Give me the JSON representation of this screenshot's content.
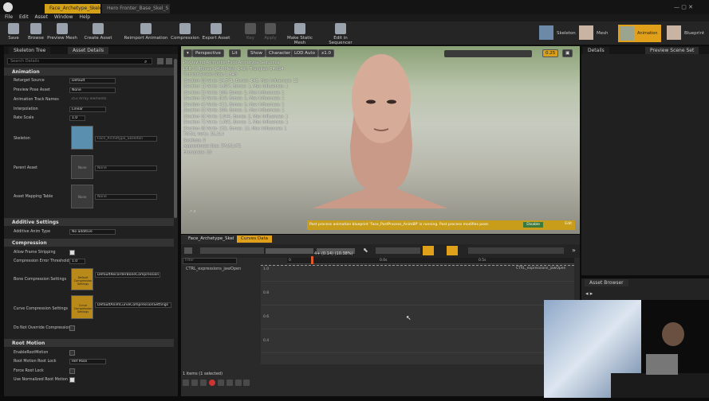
{
  "window": {
    "tabs": [
      "Face_Archetype_Skeleton",
      "Hero Fronter_Base_Skel_S"
    ],
    "menu": [
      "File",
      "Edit",
      "Asset",
      "Window",
      "Help"
    ]
  },
  "toolbar": {
    "buttons": [
      "Save",
      "Browse",
      "Preview Mesh",
      "Create Asset",
      "Reimport Animation",
      "Compression",
      "Export Asset",
      "Key",
      "Apply",
      "Make Static Mesh",
      "Edit in Sequencer"
    ],
    "modes": [
      "Skeleton",
      "Mesh",
      "Animation",
      "Blueprint"
    ]
  },
  "left_panel": {
    "tabs": [
      "Skeleton Tree",
      "Asset Details"
    ],
    "search_placeholder": "Search Details",
    "sections": {
      "animation": "Animation",
      "additive": "Additive Settings",
      "compression": "Compression",
      "root_motion": "Root Motion"
    },
    "props": {
      "retarget_source": {
        "label": "Retarget Source",
        "value": "Default"
      },
      "preview_pose": {
        "label": "Preview Pose Asset",
        "value": "None"
      },
      "track_names": {
        "label": "Animation Track Names",
        "value": "353 Array elements"
      },
      "interpolation": {
        "label": "Interpolation",
        "value": "Linear"
      },
      "rate_scale": {
        "label": "Rate Scale",
        "value": "1.0"
      },
      "skeleton": {
        "label": "Skeleton",
        "value": "Face_Archetype_Skeleton"
      },
      "parent_asset": {
        "label": "Parent Asset",
        "value": "None"
      },
      "mapping_table": {
        "label": "Asset Mapping Table",
        "value": "None"
      },
      "additive_type": {
        "label": "Additive Anim Type",
        "value": "No additive"
      },
      "allow_stripping": {
        "label": "Allow Frame Stripping"
      },
      "error_threshold": {
        "label": "Compression Error Threshold",
        "value": "1.0"
      },
      "bone_compression": {
        "label": "Bone Compression Settings",
        "value": "DefaultRecorderBoneCompression"
      },
      "curve_compression": {
        "label": "Curve Compression Settings",
        "value": "DefaultAnimCurveCompressionSettings"
      },
      "no_override": {
        "label": "Do Not Override Compression"
      },
      "enable_root": {
        "label": "EnableRootMotion"
      },
      "root_lock": {
        "label": "Root Motion Root Lock",
        "value": "Ref Pose"
      },
      "force_lock": {
        "label": "Force Root Lock"
      },
      "normalized_root": {
        "label": "Use Normalized Root Motion"
      }
    },
    "thumb_bone": "Default Compression Settings",
    "thumb_curve": "Curve Compression Settings",
    "thumb_none": "None"
  },
  "viewport": {
    "controls": [
      "Perspective",
      "Lit",
      "Show",
      "Character",
      "LOD Auto",
      "x1.0"
    ],
    "fov": "0.25",
    "info": [
      "Previewing Animation Face Archetype Sequence",
      "LOD: 0, Bones: 149 (Mesh: 149), Triangles: 54,094",
      "Current Screen Size: 1.648",
      "[Section 0] Verts: 24,571, Bones: 145, Max Influences: 12",
      "[Section 1] Verts: 4,697, Bones: 1, Max Influences: 1",
      "[Section 2] Verts: 108, Bones: 2, Max Influences: 1",
      "[Section 3] Verts: 819, Bones: 2, Max Influences: 1",
      "[Section 4] Verts: 411, Bones: 3, Max Influences: 1",
      "[Section 5] Verts: 200, Bones: 2, Max Influences: 1",
      "[Section 6] Verts: 2,944, Bones: 2, Max Influences: 1",
      "[Section 7] Verts: 1,092, Bones: 1, Max Influences: 1",
      "[Section 8] Verts: 232, Bones: 12, Max Influences: 1",
      "TOTAL Verts: 35,314",
      "Sections: 9",
      "Approximate Size: 37x51x72",
      "Framerate: 30"
    ],
    "notification": "Post process animation blueprint 'Face_PostProcess_AnimBP' is running. Post process modifies pose.",
    "notification_link": "Disable",
    "notification_edit": "Edit"
  },
  "right_panel": {
    "tabs": [
      "Details",
      "Preview Scene Set"
    ],
    "asset_browser": "Asset Browser"
  },
  "anim_editor": {
    "tabs": [
      "Face_Archetype_Skel",
      "Curves Data"
    ],
    "filter_placeholder": "Filter",
    "playhead": "4+ (0.14) (10.38%)",
    "ruler_labels": [
      "0",
      "0.0s",
      "0.5s"
    ],
    "track": "CTRL_expressions_jawOpen",
    "curve_label": "CTRL_expressions_jawOpen",
    "y_ticks": [
      "1.0",
      "0.8",
      "0.6",
      "0.4"
    ],
    "status": "1 items (1 selected)"
  },
  "colors": {
    "accent": "#e0a01a",
    "panel": "#202020",
    "toolbar": "#252525",
    "notification": "#c79d19"
  }
}
